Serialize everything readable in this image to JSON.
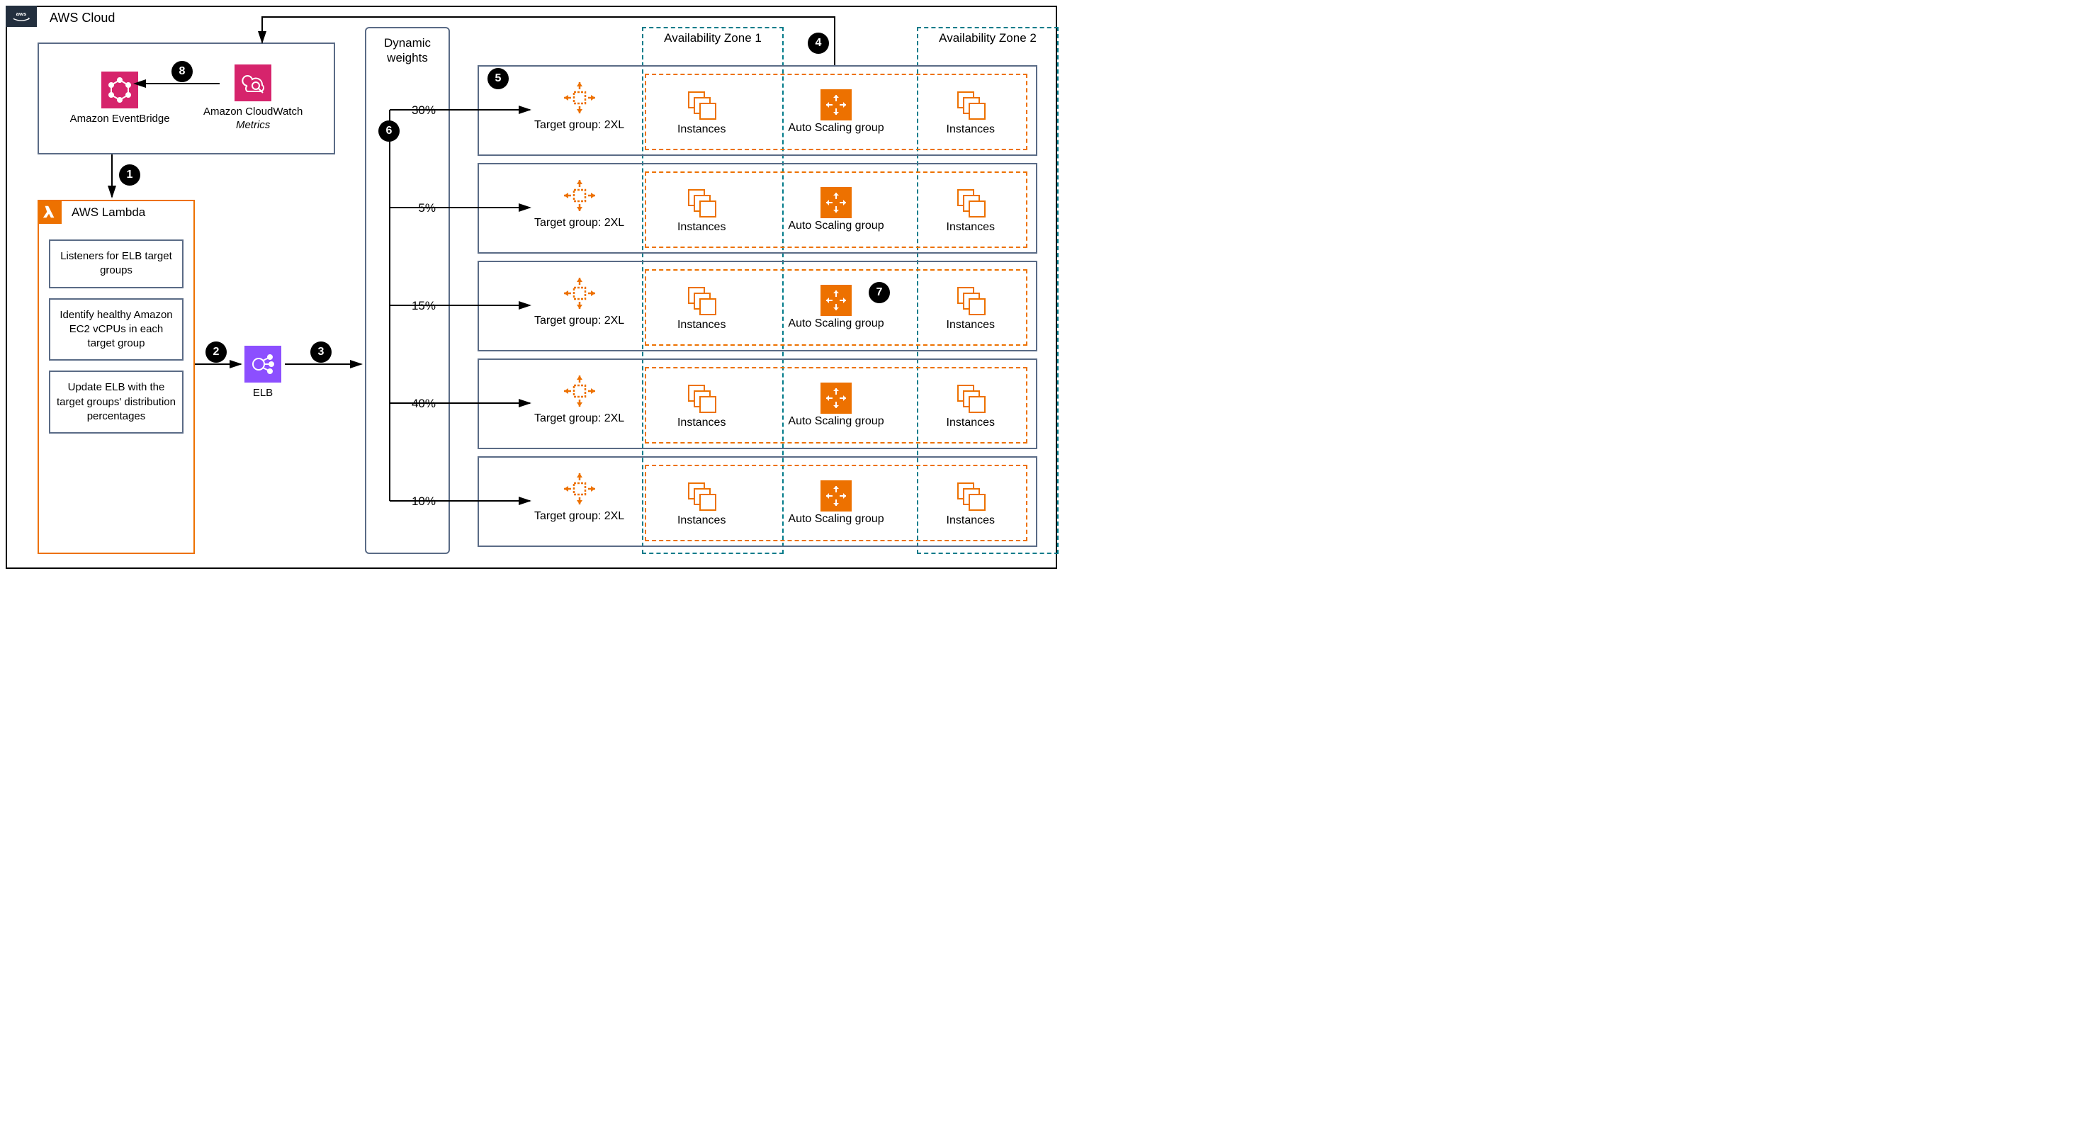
{
  "cloud_label": "AWS Cloud",
  "services": {
    "eventbridge": "Amazon EventBridge",
    "cloudwatch_line1": "Amazon CloudWatch",
    "cloudwatch_line2": "Metrics"
  },
  "lambda": {
    "title": "AWS Lambda",
    "steps": [
      "Listeners for ELB target groups",
      "Identify healthy Amazon EC2 vCPUs in each target group",
      "Update ELB with the target groups' distribution percentages"
    ]
  },
  "elb_label": "ELB",
  "weights": {
    "title": "Dynamic weights",
    "values": [
      "30%",
      "5%",
      "15%",
      "40%",
      "10%"
    ]
  },
  "target_group_label": "Target group: 2XL",
  "asg": {
    "instances_label": "Instances",
    "asg_label": "Auto Scaling group"
  },
  "az1_label": "Availability Zone 1",
  "az2_label": "Availability Zone 2",
  "step_numbers": [
    "1",
    "2",
    "3",
    "4",
    "5",
    "6",
    "7",
    "8"
  ],
  "colors": {
    "pink": "#d6246c",
    "orange": "#ed7100",
    "purple": "#8c4fff",
    "teal": "#007b8a",
    "gray": "#5a6b86"
  }
}
